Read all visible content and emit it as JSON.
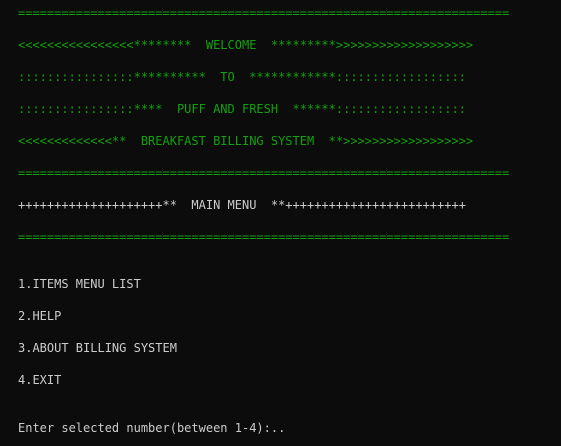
{
  "colors": {
    "background": "#0c0c0c",
    "banner_green": "#13a10e",
    "text_white": "#cccccc"
  },
  "banner": {
    "line1": "====================================================================",
    "line2": "<<<<<<<<<<<<<<<<********  WELCOME  *********>>>>>>>>>>>>>>>>>>>",
    "line3": "::::::::::::::::**********  TO  ************::::::::::::::::::",
    "line4": "::::::::::::::::****  PUFF AND FRESH  ******::::::::::::::::::",
    "line5": "<<<<<<<<<<<<<**  BREAKFAST BILLING SYSTEM  **>>>>>>>>>>>>>>>>>>",
    "line6": "===================================================================="
  },
  "menu_header": {
    "title_line": "++++++++++++++++++++**  MAIN MENU  **+++++++++++++++++++++++++",
    "divider": "===================================================================="
  },
  "menu": {
    "items": [
      "1.ITEMS MENU LIST",
      "2.HELP",
      "3.ABOUT BILLING SYSTEM",
      "4.EXIT"
    ]
  },
  "prompt": {
    "text": "Enter selected number(between 1-4):.."
  }
}
